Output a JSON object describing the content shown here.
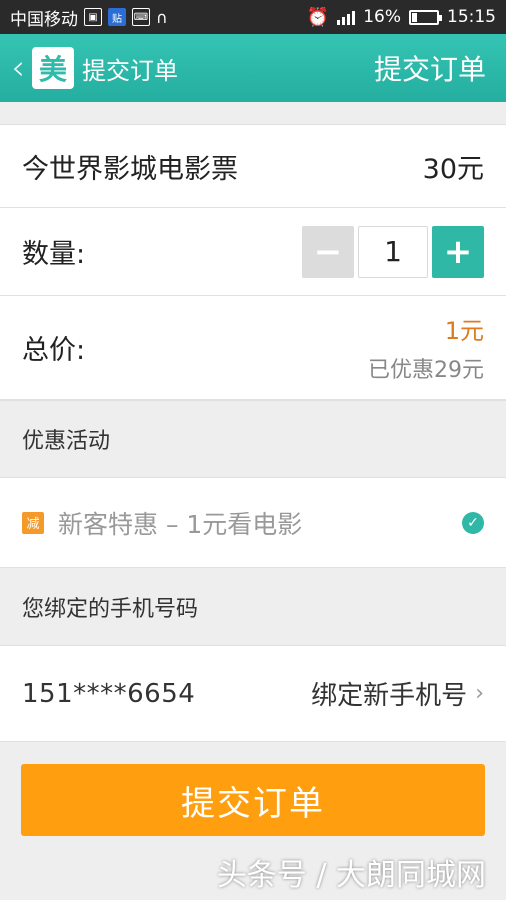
{
  "status_bar": {
    "carrier": "中国移动",
    "badge_app": "贴",
    "battery": "16%",
    "time": "15:15"
  },
  "header": {
    "logo": "美",
    "title": "提交订单",
    "action": "提交订单"
  },
  "order": {
    "product_name": "今世界影城电影票",
    "unit_price": "30元",
    "quantity_label": "数量:",
    "minus_label": "−",
    "quantity": "1",
    "plus_label": "+",
    "total_label": "总价:",
    "total_price": "1元",
    "discount_text": "已优惠29元"
  },
  "promotions": {
    "section_title": "优惠活动",
    "items": [
      {
        "icon_text": "减",
        "text": "新客特惠 – 1元看电影",
        "selected": true
      }
    ]
  },
  "phone": {
    "section_title": "您绑定的手机号码",
    "number": "151****6654",
    "bind_label": "绑定新手机号"
  },
  "submit_label": "提交订单",
  "watermark": "头条号 / 大朗同城网",
  "colors": {
    "header": "#2fbba9",
    "accent": "#2fb8a6",
    "submit": "#ff9e0e",
    "price": "#e07a1f"
  }
}
